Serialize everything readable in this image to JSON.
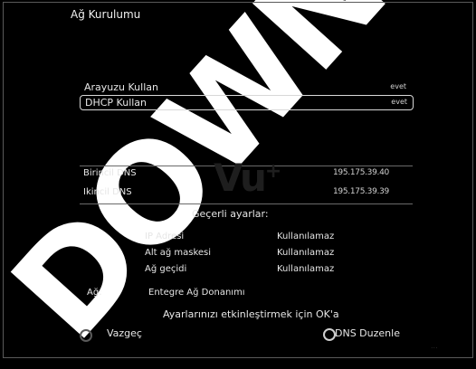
{
  "title": "Ağ Kurulumu",
  "settings": [
    {
      "label": "Arayuzu Kullan",
      "value": "evet"
    },
    {
      "label": "DHCP Kullan",
      "value": "evet"
    }
  ],
  "dns": [
    {
      "label": "Birincil DNS",
      "value": "195.175.39.40"
    },
    {
      "label": "Ikincil DNS",
      "value": "195.175.39.39"
    }
  ],
  "logo_text": "Vu",
  "logo_plus": "+",
  "current": {
    "heading": "Geçerli ayarlar:",
    "rows": [
      {
        "label": "IP Adresi",
        "value": "Kullanılamaz"
      },
      {
        "label": "Alt ağ maskesi",
        "value": "Kullanılamaz"
      },
      {
        "label": "Ağ geçidi",
        "value": "Kullanılamaz"
      }
    ]
  },
  "adapter": {
    "label": "Ağ:",
    "value": "Entegre Ağ Donanımı"
  },
  "hint": "Ayarlarınızı etkinleştirmek için OK'a",
  "buttons": {
    "cancel": "Vazgeç",
    "dns_edit": "DNS Duzenle"
  },
  "watermark": "DOWN",
  "footer_ghost": "..."
}
